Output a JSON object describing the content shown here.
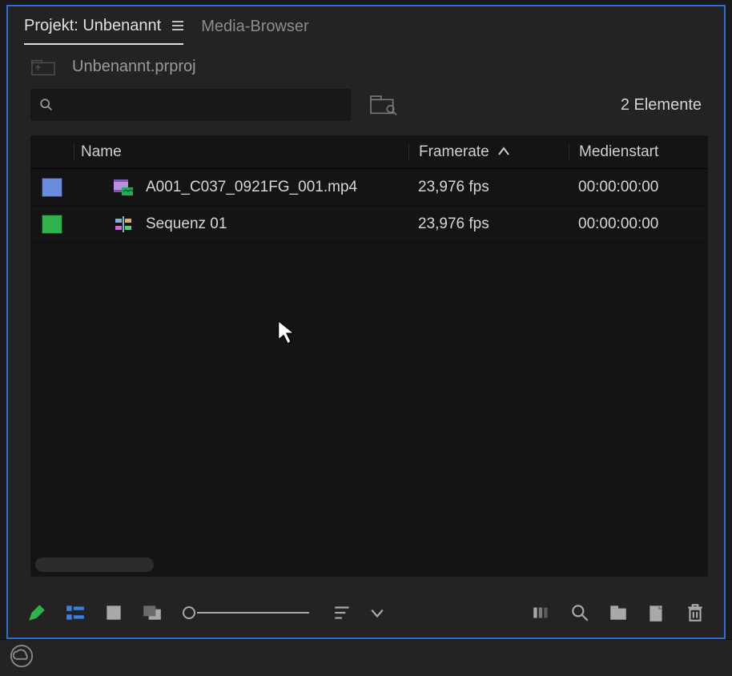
{
  "tabs": {
    "project_label": "Projekt: Unbenannt",
    "media_browser_label": "Media-Browser"
  },
  "project_file": "Unbenannt.prproj",
  "search": {
    "value": ""
  },
  "item_count_label": "2 Elemente",
  "columns": {
    "name": "Name",
    "framerate": "Framerate",
    "media_start": "Medienstart"
  },
  "items": [
    {
      "color": "#6b8bdc",
      "icon": "clip-icon",
      "name": "A001_C037_0921FG_001.mp4",
      "framerate": "23,976 fps",
      "media_start": "00:00:00:00"
    },
    {
      "color": "#2fb24b",
      "icon": "sequence-icon",
      "name": "Sequenz 01",
      "framerate": "23,976 fps",
      "media_start": "00:00:00:00"
    }
  ]
}
